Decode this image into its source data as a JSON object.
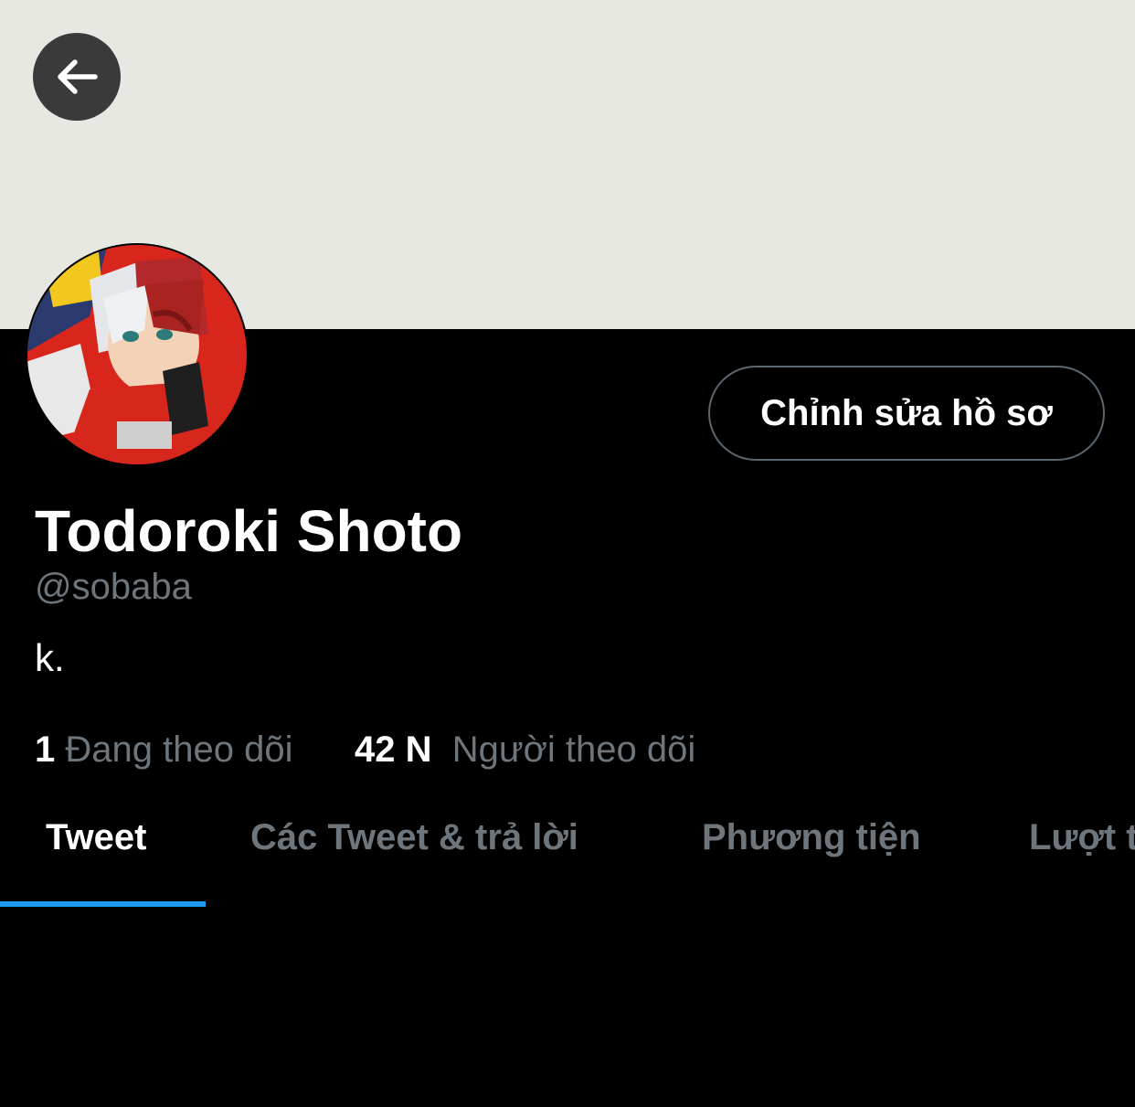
{
  "header": {
    "back_icon": "arrow-left-icon",
    "banner_color": "#e8e8e3"
  },
  "profile": {
    "edit_button_label": "Chỉnh sửa hồ sơ",
    "display_name": "Todoroki Shoto",
    "handle": "@sobaba",
    "bio": "k."
  },
  "stats": {
    "following_count": "1",
    "following_label": "Đang theo dõi",
    "followers_count": "42 N",
    "followers_label": "Người theo dõi"
  },
  "tabs": [
    {
      "label": "Tweet",
      "active": true
    },
    {
      "label": "Các Tweet & trả lời",
      "active": false
    },
    {
      "label": "Phương tiện",
      "active": false
    },
    {
      "label": "Lượt thích",
      "active": false
    }
  ],
  "colors": {
    "background": "#000000",
    "accent": "#1d9bf0",
    "secondary_text": "#6e767d",
    "button_border": "#5b6670"
  }
}
